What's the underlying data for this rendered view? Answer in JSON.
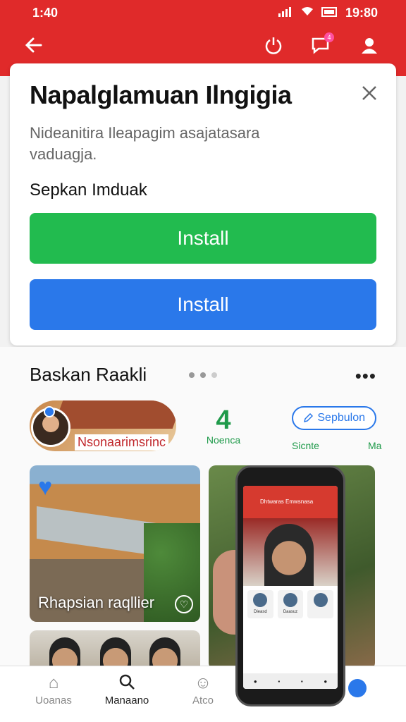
{
  "status": {
    "time_left": "1:40",
    "time_right": "19:80"
  },
  "appbar": {
    "notification_count": "4"
  },
  "dialog": {
    "title": "Napalglamuan Ilngigia",
    "description": "Nideanitira Ileapagim asajatasara vaduagja.",
    "subtitle": "Sepkan Imduak",
    "install_primary": "Install",
    "install_secondary": "Install"
  },
  "section": {
    "title": "Baskan Raakli",
    "more": "•••"
  },
  "stories": {
    "main_label": "Nsonaarimsrinc",
    "item1_icon": "4",
    "item1_label": "Noenca",
    "item2_label": "Sicnte",
    "pill_label": "Sepbulon",
    "item3_label": "Ma"
  },
  "cards": {
    "card1_caption": "Rhapsian raqllier"
  },
  "phone": {
    "header_text": "Dhtwaras Emwsnasa",
    "card_a": "Dieasd",
    "card_b": "Daasuz"
  },
  "nav": {
    "item1": "Uoanas",
    "item2": "Manaano",
    "item3": "Atco"
  },
  "colors": {
    "brand": "#e02a2a",
    "install_green": "#22bb4f",
    "install_blue": "#2a78ea"
  }
}
